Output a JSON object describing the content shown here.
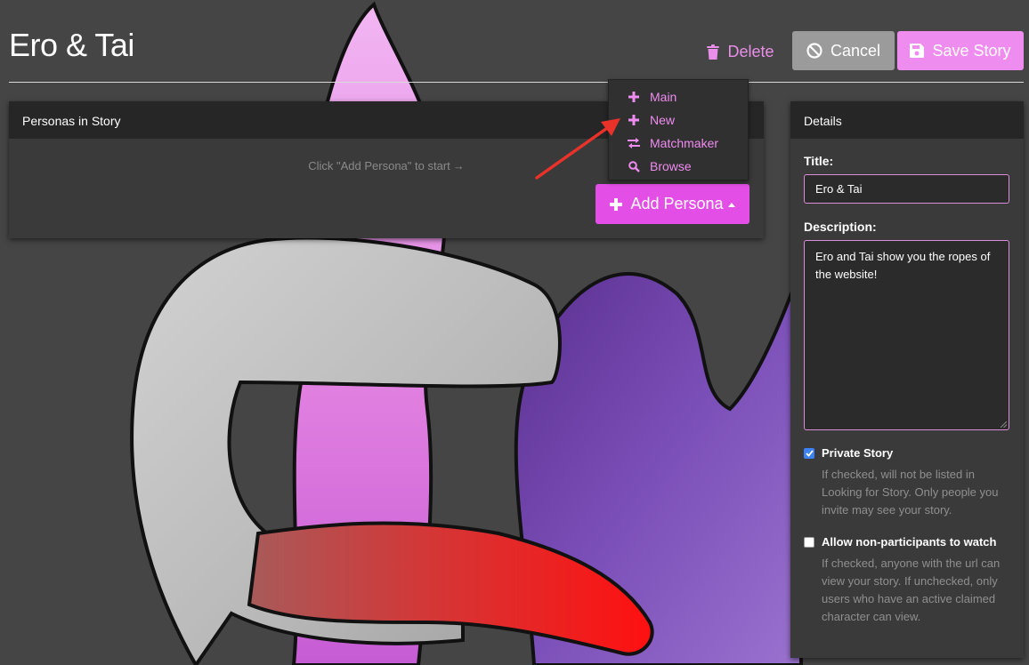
{
  "header": {
    "title": "Ero & Tai",
    "delete_label": "Delete",
    "cancel_label": "Cancel",
    "save_label": "Save Story"
  },
  "personas_panel": {
    "heading": "Personas in Story",
    "empty_hint": "Click \"Add Persona\" to start",
    "add_button_label": "Add Persona"
  },
  "add_persona_menu": {
    "items": [
      {
        "label": "Main",
        "icon": "plus-icon"
      },
      {
        "label": "New",
        "icon": "plus-icon"
      },
      {
        "label": "Matchmaker",
        "icon": "exchange-icon"
      },
      {
        "label": "Browse",
        "icon": "search-icon"
      }
    ]
  },
  "details": {
    "heading": "Details",
    "title_label": "Title:",
    "title_value": "Ero & Tai",
    "description_label": "Description:",
    "description_value": "Ero and Tai show you the ropes of the website!",
    "private_story": {
      "label": "Private Story",
      "checked": true,
      "help": "If checked, will not be listed in Looking for Story. Only people you invite may see your story."
    },
    "allow_watch": {
      "label": "Allow non-participants to watch",
      "checked": false,
      "help": "If checked, anyone with the url can view your story. If unchecked, only users who have an active claimed character can view."
    }
  },
  "colors": {
    "background": "#454545",
    "accent": "#e34fe6",
    "accent_light": "#ef8cef",
    "panel": "#3a3a3a",
    "panel_header": "#262626",
    "annotation_arrow": "#e8322a"
  }
}
